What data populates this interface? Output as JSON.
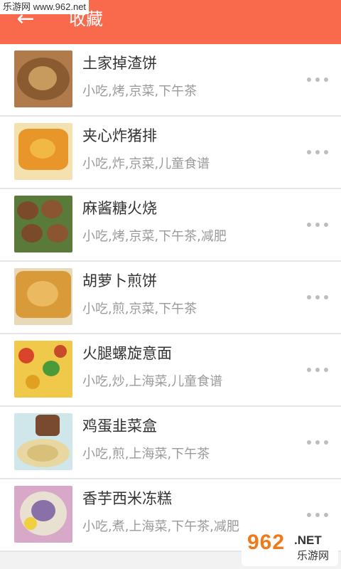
{
  "watermark": "乐游网 www.962.net",
  "header": {
    "back_icon": "arrow-left-icon",
    "title": "收藏"
  },
  "items": [
    {
      "name": "土家掉渣饼",
      "tags": "小吃,烤,京菜,下午茶"
    },
    {
      "name": "夹心炸猪排",
      "tags": "小吃,炸,京菜,儿童食谱"
    },
    {
      "name": "麻酱糖火烧",
      "tags": "小吃,烤,京菜,下午茶,减肥"
    },
    {
      "name": "胡萝卜煎饼",
      "tags": "小吃,煎,京菜,下午茶"
    },
    {
      "name": "火腿螺旋意面",
      "tags": "小吃,炒,上海菜,儿童食谱"
    },
    {
      "name": "鸡蛋韭菜盒",
      "tags": "小吃,煎,上海菜,下午茶"
    },
    {
      "name": "香芋西米冻糕",
      "tags": "小吃,煮,上海菜,下午茶,减肥"
    }
  ],
  "logo": {
    "big": "962",
    "net": ".NET",
    "cn": "乐游网"
  },
  "colors": {
    "header": "#f96a4d",
    "divider": "#e6e6e6"
  }
}
